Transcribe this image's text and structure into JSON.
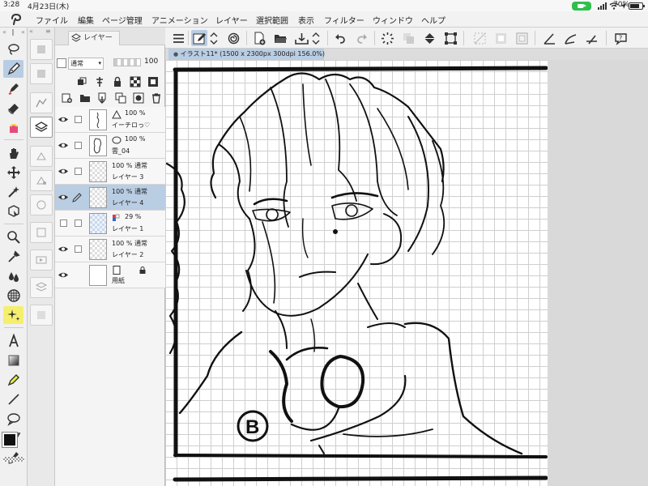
{
  "status_bar": {
    "time": "3:28",
    "date": "4月23日(木)",
    "battery": "70%"
  },
  "menu": {
    "items": [
      "ファイル",
      "編集",
      "ページ管理",
      "アニメーション",
      "レイヤー",
      "選択範囲",
      "表示",
      "フィルター",
      "ウィンドウ",
      "ヘルプ"
    ]
  },
  "layer_panel": {
    "tab_label": "レイヤー",
    "blend_mode": "通常",
    "opacity": "100",
    "layers": [
      {
        "opacity": "100 %",
        "name": "イーチロっ♡",
        "thumb": "figure",
        "selected": false
      },
      {
        "opacity": "100 %",
        "name": "雲_04",
        "thumb": "cloud",
        "selected": false
      },
      {
        "opacity": "100 %",
        "blend": "通常",
        "name": "レイヤー 3",
        "thumb": "checker",
        "selected": false
      },
      {
        "opacity": "100 %",
        "blend": "通常",
        "name": "レイヤー 4",
        "thumb": "checker",
        "selected": true
      },
      {
        "opacity": "29 %",
        "name": "レイヤー 1",
        "thumb": "blue",
        "selected": false
      },
      {
        "opacity": "100 %",
        "blend": "通常",
        "name": "レイヤー 2",
        "thumb": "checker",
        "selected": false
      },
      {
        "name": "用紙",
        "thumb": "white",
        "selected": false
      }
    ]
  },
  "document": {
    "tab_label": "イラスト11* (1500 x 2300px 300dpi 156.0%)"
  },
  "canvas": {
    "badge_letter": "B"
  },
  "colors": {
    "accent": "#b8cde3",
    "camera_pill": "#2fbf4c"
  }
}
